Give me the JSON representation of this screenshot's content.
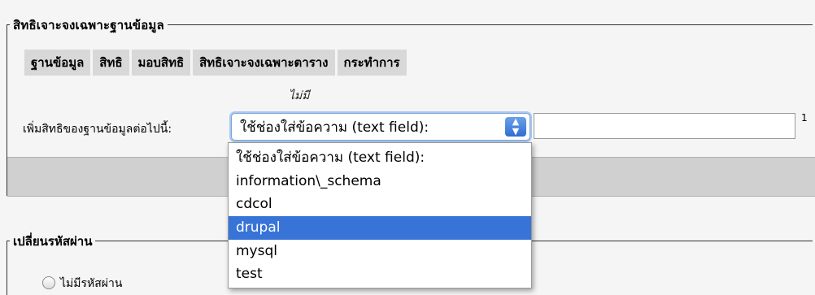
{
  "db_privileges": {
    "legend": "สิทธิเจาะจงเฉพาะฐานข้อมูล",
    "columns": [
      "ฐานข้อมูล",
      "สิทธิ",
      "มอบสิทธิ",
      "สิทธิเจาะจงเฉพาะตาราง",
      "กระทำการ"
    ],
    "empty_text": "ไม่มี",
    "add_label": "เพิ่มสิทธิของฐานข้อมูลต่อไปนี้:",
    "select_value": "ใช้ช่องใส่ข้อความ (text field):",
    "superscript": "1",
    "options": [
      "ใช้ช่องใส่ข้อความ (text field):",
      "information\\_schema",
      "cdcol",
      "drupal",
      "mysql",
      "test"
    ],
    "highlighted_option": "drupal"
  },
  "change_password": {
    "legend": "เปลี่ยนรหัสผ่าน",
    "no_password_label": "ไม่มีรหัสผ่าน"
  },
  "colors": {
    "highlight": "#3874d8",
    "header_bg": "#d8d8d8"
  }
}
